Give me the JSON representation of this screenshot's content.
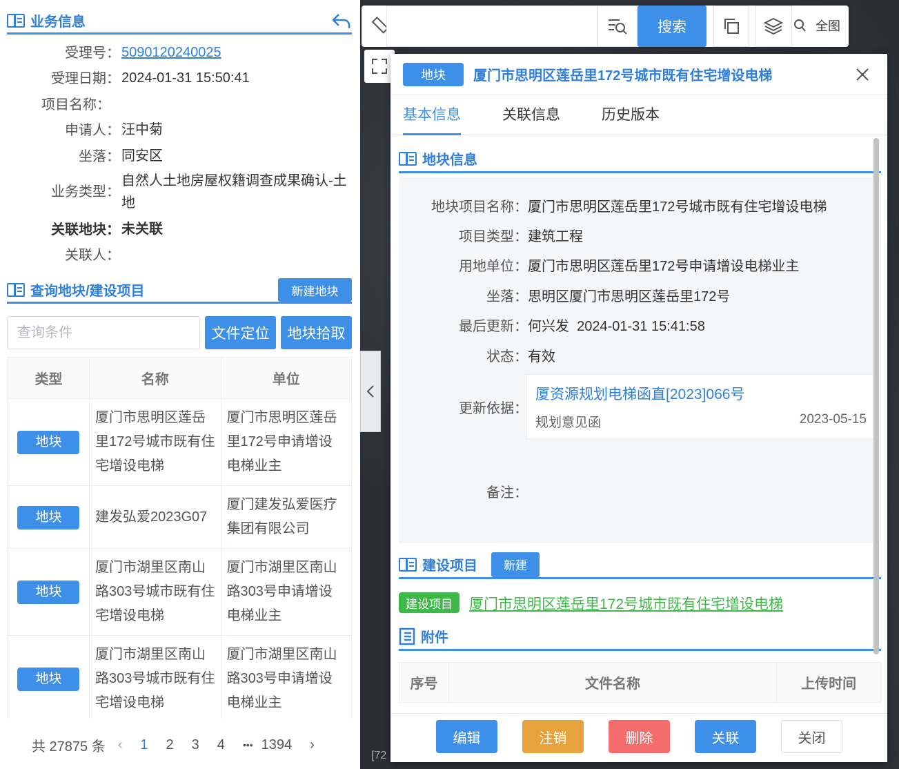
{
  "business": {
    "title": "业务信息",
    "rows": [
      {
        "label": "受理号：",
        "value": "5090120240025"
      },
      {
        "label": "受理日期：",
        "value": "2024-01-31 15:50:41"
      },
      {
        "label": "项目名称：",
        "value": ""
      },
      {
        "label": "申请人：",
        "value": "汪中菊"
      },
      {
        "label": "坐落：",
        "value": "同安区"
      },
      {
        "label": "业务类型：",
        "value": "自然人土地房屋权籍调查成果确认-土地"
      },
      {
        "label": "关联地块：",
        "value": "未关联"
      },
      {
        "label": "关联人：",
        "value": ""
      }
    ]
  },
  "query": {
    "title": "查询地块/建设项目",
    "new_button": "新建地块",
    "search_placeholder": "查询条件",
    "locate_button": "文件定位",
    "pick_button": "地块拾取",
    "columns": [
      "类型",
      "名称",
      "单位"
    ],
    "rows": [
      {
        "type": "地块",
        "name": "厦门市思明区莲岳里172号城市既有住宅增设电梯",
        "unit": "厦门市思明区莲岳里172号申请增设电梯业主"
      },
      {
        "type": "地块",
        "name": "建发弘爱2023G07",
        "unit": "厦门建发弘爱医疗集团有限公司"
      },
      {
        "type": "地块",
        "name": "厦门市湖里区南山路303号城市既有住宅增设电梯",
        "unit": "厦门市湖里区南山路303号申请增设电梯业主"
      },
      {
        "type": "地块",
        "name": "厦门市湖里区南山路303号城市既有住宅增设电梯",
        "unit": "厦门市湖里区南山路303号申请增设电梯业主"
      }
    ],
    "pager": {
      "total": "共 27875 条",
      "pages": [
        "1",
        "2",
        "3",
        "4"
      ],
      "ellipsis": "•••",
      "last": "1394"
    }
  },
  "map": {
    "search_button": "搜索",
    "full_view": "全图",
    "coord_prefix": "[72"
  },
  "popup": {
    "tag": "地块",
    "title": "厦门市思明区莲岳里172号城市既有住宅增设电梯",
    "tabs": [
      "基本信息",
      "关联信息",
      "历史版本"
    ],
    "parcel_section": "地块信息",
    "details": [
      {
        "label": "地块项目名称：",
        "value": "厦门市思明区莲岳里172号城市既有住宅增设电梯"
      },
      {
        "label": "项目类型：",
        "value": "建筑工程"
      },
      {
        "label": "用地单位：",
        "value": "厦门市思明区莲岳里172号申请增设电梯业主"
      },
      {
        "label": "坐落：",
        "value": "思明区厦门市思明区莲岳里172号"
      },
      {
        "label": "最后更新：",
        "value": "何兴发  2024-01-31 15:41:58"
      },
      {
        "label": "状态：",
        "value": "有效"
      },
      {
        "label": "更新依据：",
        "value": ""
      },
      {
        "label": "备注：",
        "value": ""
      }
    ],
    "basis": {
      "link": "厦资源规划电梯函直[2023]066号",
      "type": "规划意见函",
      "date": "2023-05-15"
    },
    "project_section": "建设项目",
    "project_new": "新建",
    "project_tag": "建设项目",
    "project_link": "厦门市思明区莲岳里172号城市既有住宅增设电梯",
    "attach_section": "附件",
    "attach_columns": [
      "序号",
      "文件名称",
      "上传时间"
    ],
    "buttons": {
      "edit": "编辑",
      "cancel": "注销",
      "delete": "删除",
      "link": "关联",
      "close": "关闭"
    }
  },
  "colors": {
    "primary": "#3d8fe8",
    "green": "#3fb84a",
    "orange": "#e6a23c",
    "red": "#f56c6c"
  }
}
